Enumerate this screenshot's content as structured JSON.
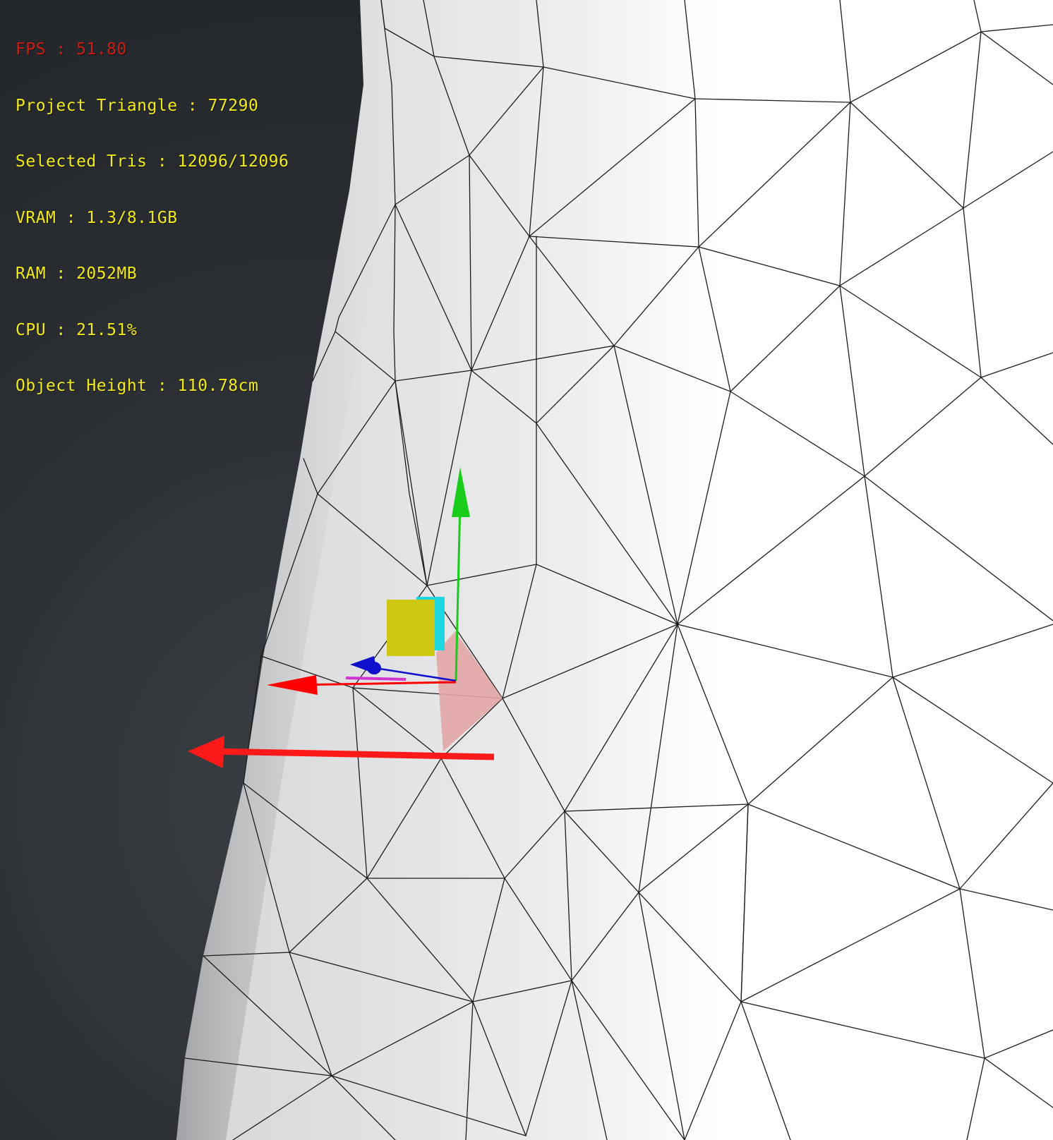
{
  "hud": {
    "fps": "FPS : 51.80",
    "project_triangles": "Project Triangle : 77290",
    "selected_tris": "Selected Tris : 12096/12096",
    "vram": "VRAM : 1.3/8.1GB",
    "ram": "RAM : 2052MB",
    "cpu": "CPU : 21.51%",
    "object_height": "Object Height : 110.78cm"
  },
  "colors": {
    "fps_text": "#cc1d14",
    "hud_text": "#f2ea1a",
    "background": "#2a2d31",
    "mesh_surface": "#ffffff",
    "mesh_wire": "#1c1c1c",
    "gizmo_x_axis": "#ff0000",
    "gizmo_y_axis": "#19cc19",
    "gizmo_z_axis": "#1010cc",
    "gizmo_center_yellow": "#cfc813",
    "gizmo_center_cyan": "#1fd6e0",
    "selected_face": "#e3a6a6",
    "annotation_arrow": "#ff1a1a"
  },
  "icons": {
    "gizmo": "transform-gizmo-icon",
    "annotation": "red-arrow-left-icon"
  }
}
